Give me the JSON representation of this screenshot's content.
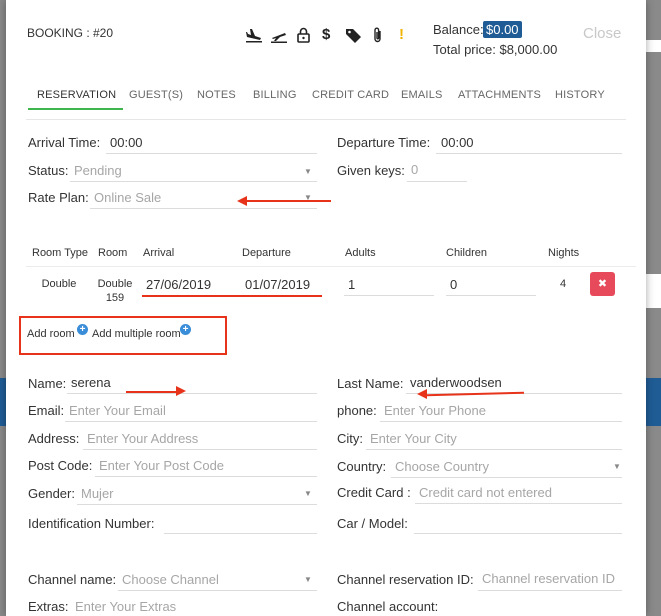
{
  "header": {
    "booking_label": "BOOKING : #20",
    "balance_label": "Balance:",
    "balance_value": "$0.00",
    "total_label": "Total price: $8,000.00",
    "close_label": "Close",
    "icons": [
      "airplane-arrival-icon",
      "airplane-departure-icon",
      "lock-icon",
      "dollar-icon",
      "tag-icon",
      "paperclip-icon",
      "warning-icon"
    ]
  },
  "tabs": [
    "RESERVATION",
    "GUEST(S)",
    "NOTES",
    "BILLING",
    "CREDIT CARD",
    "EMAILS",
    "ATTACHMENTS",
    "HISTORY"
  ],
  "reservation": {
    "arrival_label": "Arrival Time:",
    "arrival_value": "00:00",
    "departure_label": "Departure Time:",
    "departure_value": "00:00",
    "status_label": "Status:",
    "status_value": "Pending",
    "keys_label": "Given keys:",
    "keys_value": "0",
    "rate_label": "Rate Plan:",
    "rate_value": "Online Sale"
  },
  "rooms_table": {
    "headers": [
      "Room Type",
      "Room",
      "Arrival",
      "Departure",
      "Adults",
      "Children",
      "Nights"
    ],
    "row": {
      "room_type": "Double",
      "room_line1": "Double",
      "room_line2": "159",
      "arrival": "27/06/2019",
      "departure": "01/07/2019",
      "adults": "1",
      "children": "0",
      "nights": "4",
      "delete": "✖"
    }
  },
  "add_room": {
    "add_room_label": "Add room",
    "add_multiple_label": "Add multiple room"
  },
  "guest": {
    "name_label": "Name:",
    "name_value": "serena",
    "last_name_label": "Last Name:",
    "last_name_value": "vanderwoodsen",
    "email_label": "Email:",
    "email_ph": "Enter Your Email",
    "phone_label": "phone:",
    "phone_ph": "Enter Your Phone",
    "address_label": "Address:",
    "address_ph": "Enter Your Address",
    "city_label": "City:",
    "city_ph": "Enter Your City",
    "postcode_label": "Post Code:",
    "postcode_ph": "Enter Your Post Code",
    "country_label": "Country:",
    "country_ph": "Choose Country",
    "gender_label": "Gender:",
    "gender_value": "Mujer",
    "credit_label": "Credit Card :",
    "credit_ph": "Credit card not entered",
    "id_label": "Identification Number:",
    "car_label": "Car / Model:",
    "channel_label": "Channel name:",
    "channel_ph": "Choose Channel",
    "channel_res_label": "Channel reservation ID:",
    "channel_res_ph": "Channel reservation ID",
    "extras_label": "Extras:",
    "extras_ph": "Enter Your Extras",
    "channel_account_label": "Channel account:"
  },
  "colors": {
    "accent_green": "#3fb54e",
    "brand_blue": "#1f5c95",
    "annotation_red": "#e8331b",
    "delete_red": "#e74a5a"
  }
}
